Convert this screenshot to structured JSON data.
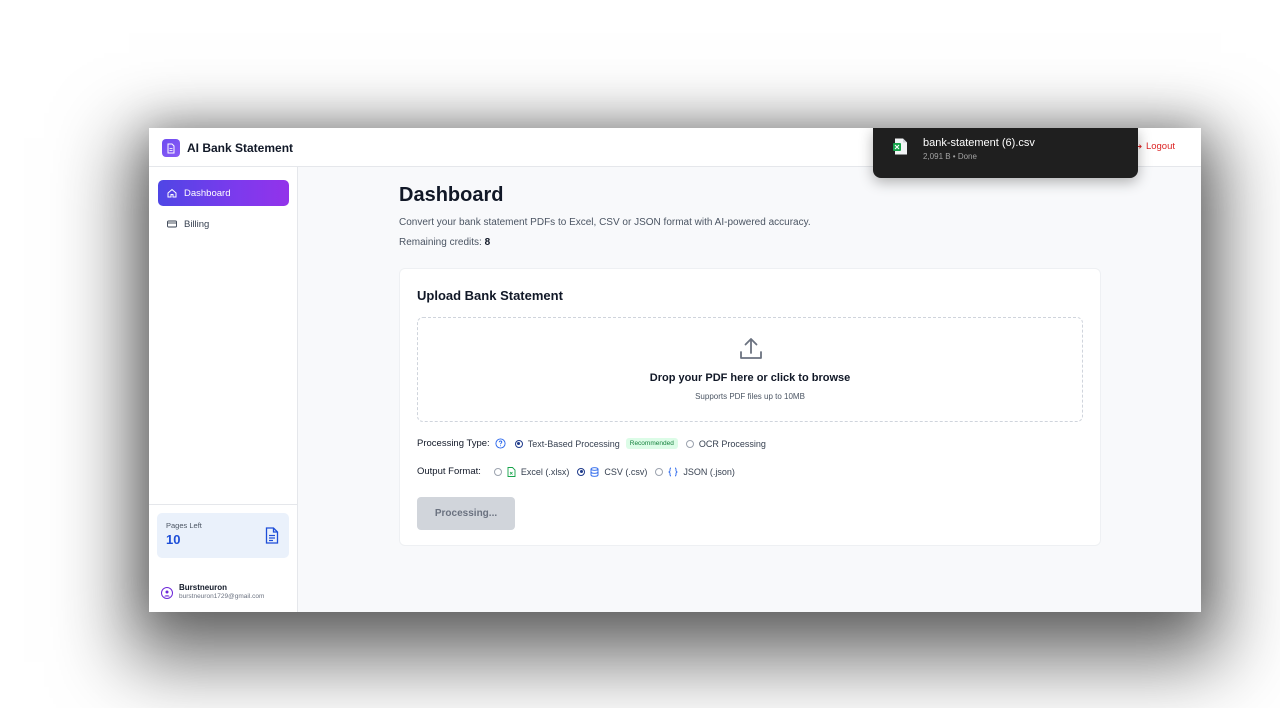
{
  "app": {
    "name": "AI Bank Statement"
  },
  "header": {
    "logout_label": "Logout"
  },
  "sidebar": {
    "items": [
      {
        "label": "Dashboard",
        "icon": "home-icon",
        "active": true
      },
      {
        "label": "Billing",
        "icon": "credit-card-icon",
        "active": false
      }
    ],
    "pages_left": {
      "label": "Pages Left",
      "value": "10"
    },
    "user": {
      "name": "Burstneuron",
      "email": "burstneuron1729@gmail.com"
    }
  },
  "main": {
    "title": "Dashboard",
    "subtitle": "Convert your bank statement PDFs to Excel, CSV or JSON format with AI-powered accuracy.",
    "credits_label": "Remaining credits:",
    "credits_value": "8",
    "upload": {
      "title": "Upload Bank Statement",
      "drop_title": "Drop your PDF here or click to browse",
      "drop_sub": "Supports PDF files up to 10MB",
      "processing_type": {
        "label": "Processing Type:",
        "options": [
          {
            "label": "Text-Based Processing",
            "badge": "Recommended",
            "selected": true
          },
          {
            "label": "OCR Processing",
            "selected": false
          }
        ]
      },
      "output_format": {
        "label": "Output Format:",
        "options": [
          {
            "label": "Excel (.xlsx)",
            "icon": "excel-file-icon",
            "selected": false
          },
          {
            "label": "CSV (.csv)",
            "icon": "database-icon",
            "selected": true
          },
          {
            "label": "JSON (.json)",
            "icon": "braces-icon",
            "selected": false
          }
        ]
      },
      "button_label": "Processing..."
    }
  },
  "download_toast": {
    "file_name": "bank-statement (6).csv",
    "meta": "2,091 B • Done"
  },
  "colors": {
    "accent_start": "#4f46e5",
    "accent_end": "#9333ea",
    "logout": "#dc2626",
    "pages_value": "#1d4ed8",
    "badge_bg": "#dcfce7",
    "badge_text": "#15803d"
  }
}
